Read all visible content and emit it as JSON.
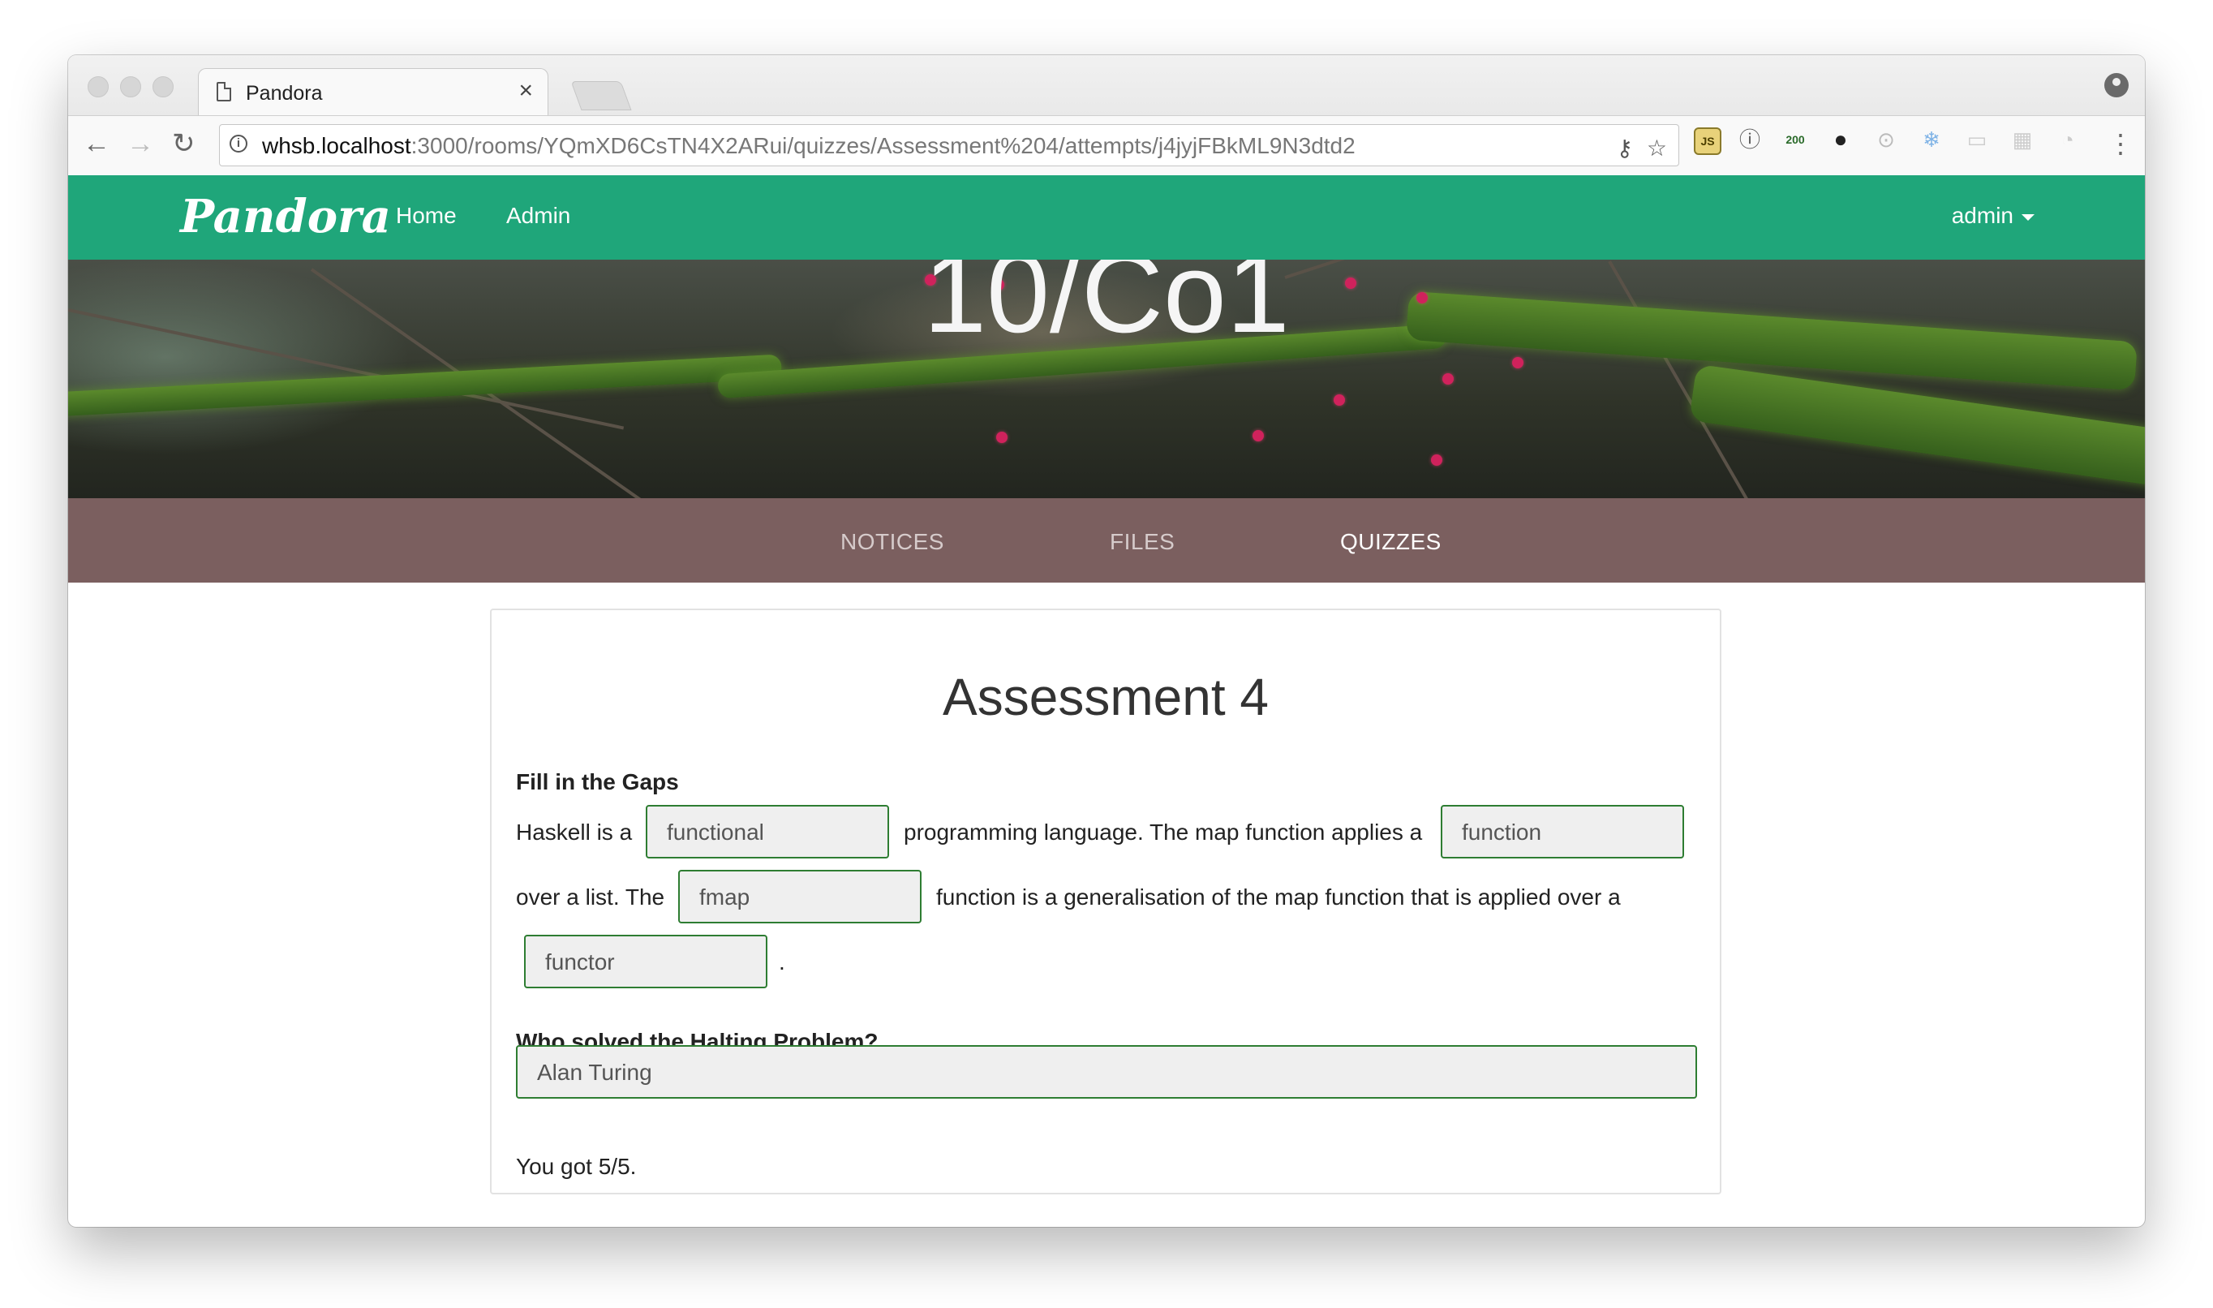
{
  "browser": {
    "tab_title": "Pandora",
    "tab_close": "×",
    "url_host": "whsb.localhost",
    "url_rest": ":3000/rooms/YQmXD6CsTN4X2ARui/quizzes/Assessment%204/attempts/j4jyjFBkML9N3dtd2",
    "back": "←",
    "forward": "→",
    "reload": "↻",
    "key_icon": "⚷",
    "star": "☆",
    "menu": "⋮",
    "extensions": [
      "JS",
      "ⓘ",
      "200",
      "●",
      "⊙",
      "❄",
      "▭",
      "▦",
      "◔"
    ]
  },
  "appnav": {
    "brand": "Pandora",
    "links": [
      "Home",
      "Admin"
    ],
    "user": "admin"
  },
  "hero": {
    "title": "10/Co1"
  },
  "subnav": {
    "tabs": [
      "NOTICES",
      "FILES",
      "QUIZZES"
    ],
    "active": "QUIZZES"
  },
  "quiz": {
    "title": "Assessment 4",
    "q1": {
      "label": "Fill in the Gaps",
      "t1": "Haskell is a",
      "a1": "functional",
      "t2": "programming language. The map function applies a",
      "a2": "function",
      "t3": "over a list. The",
      "a3": "fmap",
      "t4": "function is a generalisation of the map function that is applied over a",
      "a4": "functor",
      "t5": "."
    },
    "q2": {
      "label": "Who solved the Halting Problem?",
      "answer": "Alan Turing"
    },
    "result": "You got 5/5."
  },
  "colors": {
    "navbar": "#1fa67a",
    "subnav": "#7b5f5f",
    "answer_border": "#2e7d32"
  }
}
